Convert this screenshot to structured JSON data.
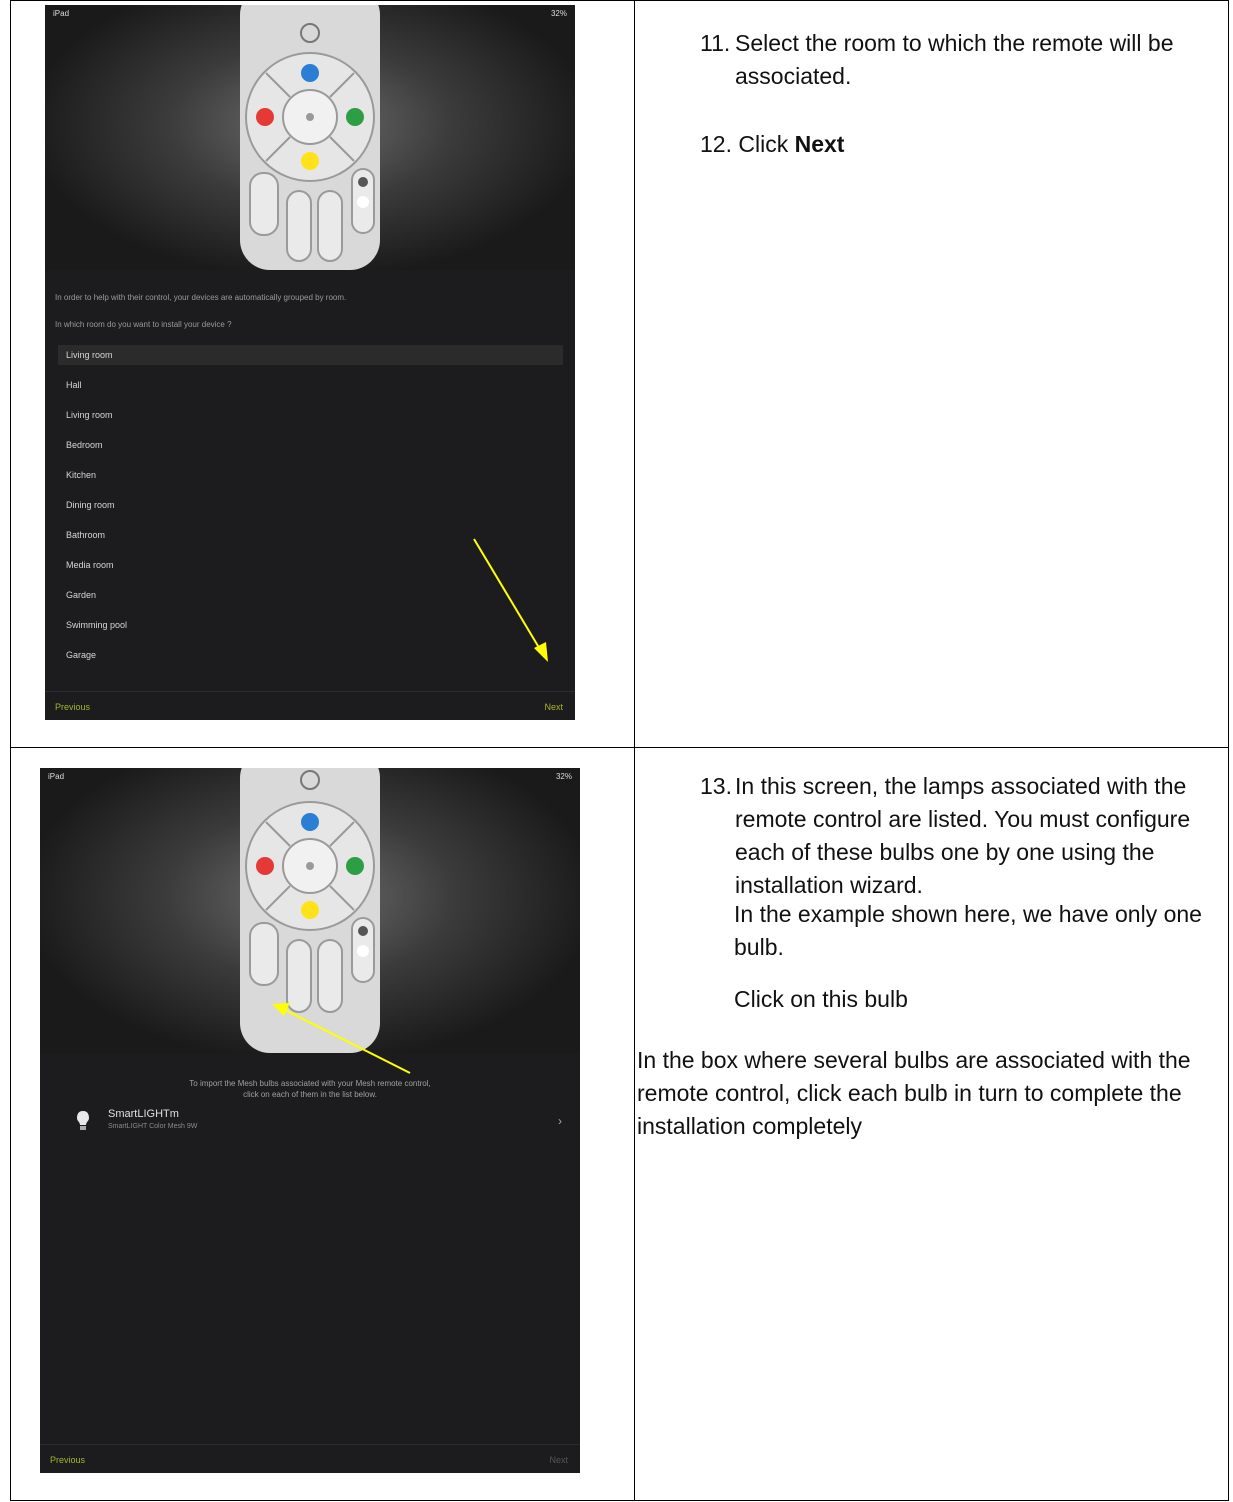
{
  "screen1": {
    "status_left": "iPad",
    "status_right": "32%",
    "msg1": "In order to help with their control, your devices are automatically grouped by room.",
    "msg2": "In which room do you want to install your device ?",
    "selected_room": "Living room",
    "rooms": [
      "Hall",
      "Living room",
      "Bedroom",
      "Kitchen",
      "Dining room",
      "Bathroom",
      "Media room",
      "Garden",
      "Swimming pool",
      "Garage"
    ],
    "previous": "Previous",
    "next": "Next"
  },
  "screen2": {
    "status_left": "iPad",
    "status_right": "32%",
    "intro_line1": "To import the Mesh bulbs associated with your Mesh remote control,",
    "intro_line2": "click on each of them in the list below.",
    "bulb_name": "SmartLIGHTm",
    "bulb_model": "SmartLIGHT Color Mesh 9W",
    "previous": "Previous",
    "next": "Next"
  },
  "instructions": {
    "step11_num": "11.",
    "step11_text": "Select the room to which the remote will be associated.",
    "step12_num": "12.",
    "step12_text": "Click",
    "step12_bold": "Next",
    "step13_num": "13.",
    "step13_text": "In this screen, the lamps associated with the remote control are listed. You must configure each of these bulbs one by one using the installation wizard.",
    "step13_example": "In the example shown here, we have only one bulb.",
    "step13_click": "Click on this bulb",
    "note": "In the box where several bulbs are associated with the remote control, click each bulb in turn to complete the installation completely"
  },
  "colors": {
    "arrow": "#ffff00",
    "accent_green": "#a5b52a",
    "btn_blue": "#2a7fd4",
    "btn_red": "#e53935",
    "btn_green": "#2e9e44",
    "btn_yellow": "#ffe21a"
  }
}
